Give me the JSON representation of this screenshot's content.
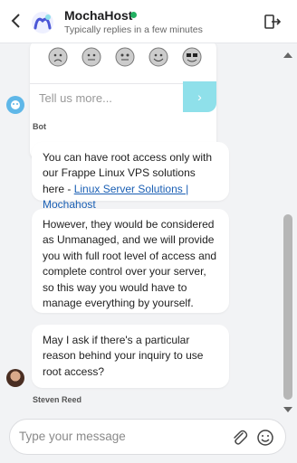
{
  "header": {
    "title": "MochaHost",
    "subtitle": "Typically replies in a few minutes",
    "status_color": "#21b061"
  },
  "rating": {
    "faces": [
      "very-sad-face-icon",
      "neutral-face-icon",
      "flat-face-icon",
      "happy-face-icon",
      "cool-sunglasses-face-icon"
    ],
    "input_placeholder": "Tell us more...",
    "send_color": "#8fe0ea"
  },
  "bot": {
    "label": "Bot"
  },
  "messages": [
    {
      "text_before": "You can have root access only with our Frappe Linux VPS solutions here - ",
      "link": "Linux Server Solutions | Mochahost"
    },
    {
      "text": "However, they would be considered as Unmanaged, and we will provide you with full root level of access and complete control over your server, so this way you would have to manage everything by yourself."
    },
    {
      "text": "May I ask if there's a particular reason behind your inquiry to use root access?"
    }
  ],
  "agent": {
    "name": "Steven Reed"
  },
  "composer": {
    "placeholder": "Type your message"
  }
}
